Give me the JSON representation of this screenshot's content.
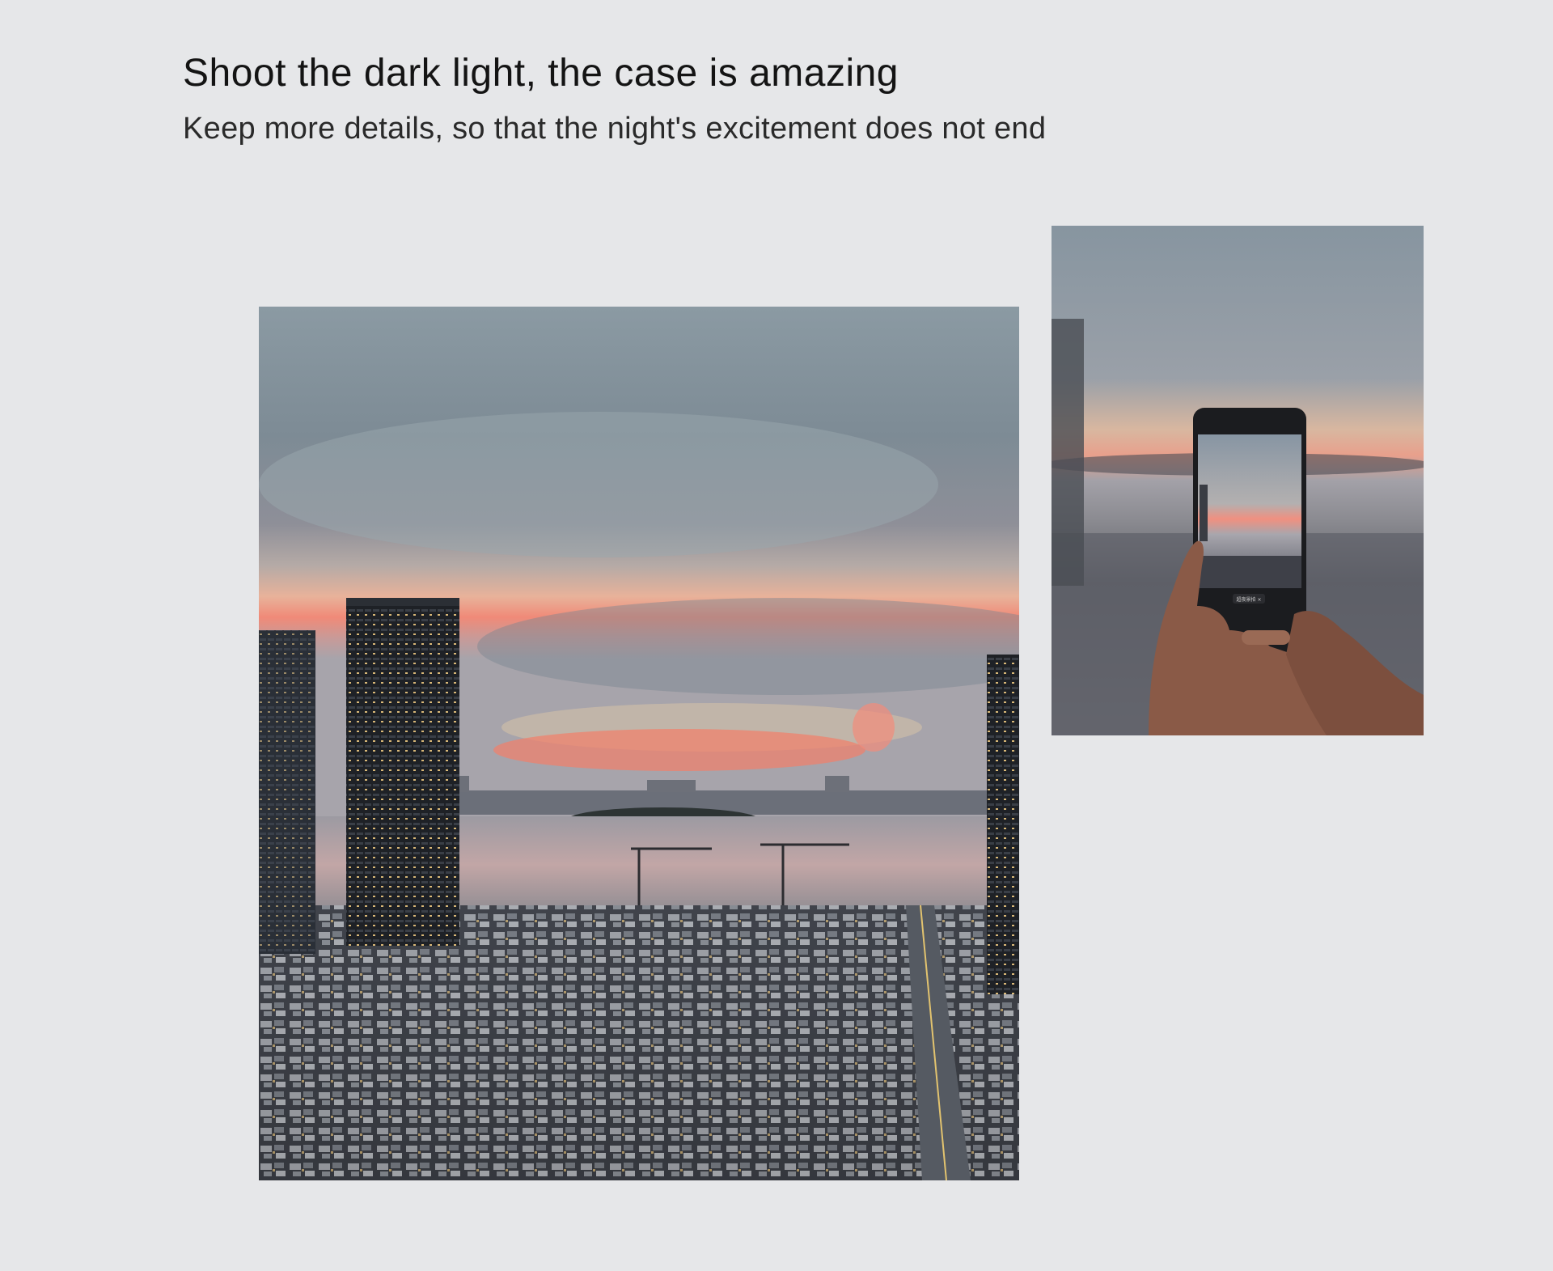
{
  "section": {
    "headline": "Shoot the dark light, the case is amazing",
    "subheadline": "Keep more details, so that the night's excitement does not end"
  },
  "photos": {
    "main": {
      "subject": "night-cityscape-sunset-photo"
    },
    "side": {
      "subject": "hands-holding-phone-photo",
      "phone_mode_label": "超夜景拍 ×"
    }
  },
  "colors": {
    "background": "#e6e7e9",
    "headline": "#141414",
    "subheadline": "#2a2a2a"
  }
}
